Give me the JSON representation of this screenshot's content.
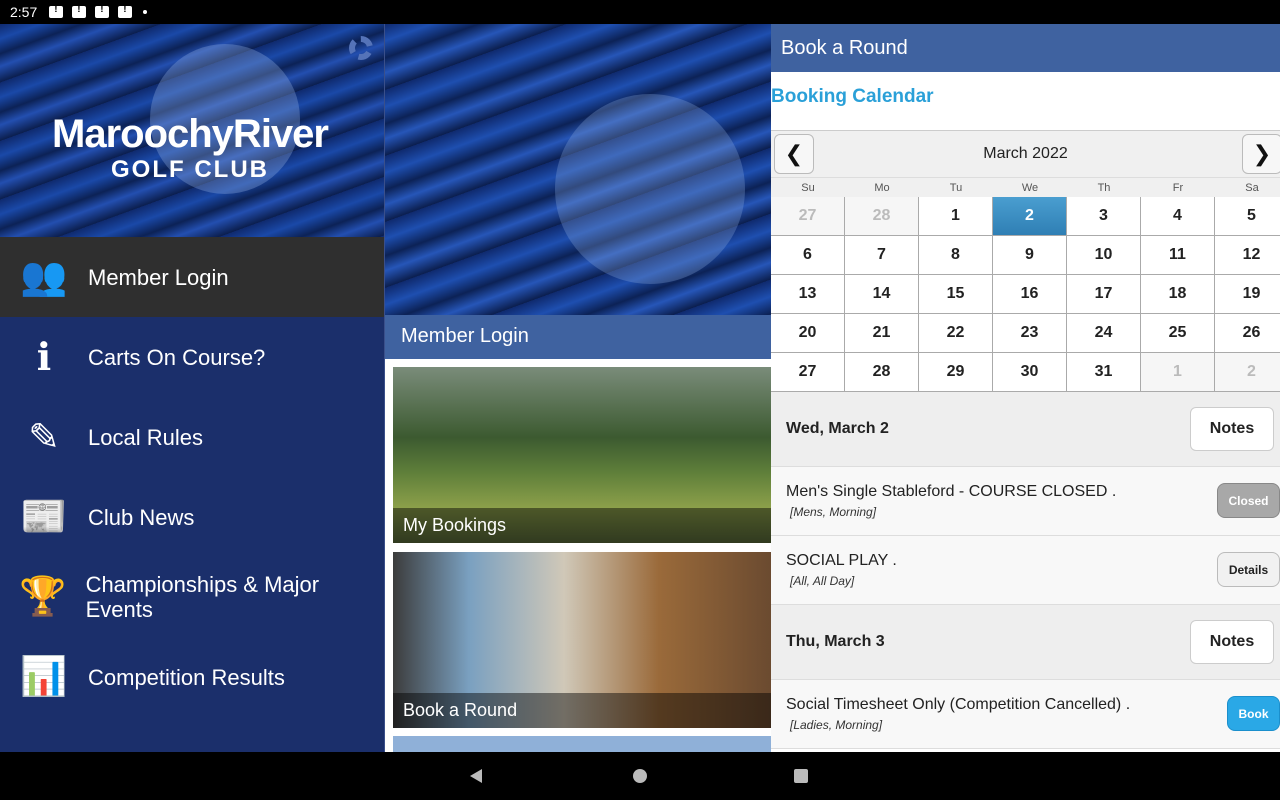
{
  "status_bar": {
    "time": "2:57"
  },
  "left_panel": {
    "logo": {
      "main": "MaroochyRiver",
      "sub": "GOLF CLUB"
    },
    "menu": [
      {
        "label": "Member Login",
        "icon": "members-icon",
        "active": true
      },
      {
        "label": "Carts On Course?",
        "icon": "info-icon",
        "active": false
      },
      {
        "label": "Local Rules",
        "icon": "edit-icon",
        "active": false
      },
      {
        "label": "Club News",
        "icon": "news-icon",
        "active": false
      },
      {
        "label": "Championships & Major Events",
        "icon": "trophy-icon",
        "active": false
      },
      {
        "label": "Competition Results",
        "icon": "bar-chart-icon",
        "active": false
      }
    ]
  },
  "middle_panel": {
    "header": "Member Login",
    "tiles": [
      {
        "label": "My Bookings"
      },
      {
        "label": "Book a Round"
      }
    ]
  },
  "right_panel": {
    "header": "Book a Round",
    "booking_calendar_label": "Booking Calendar",
    "calendar": {
      "month": "March 2022",
      "weekdays": [
        "Su",
        "Mo",
        "Tu",
        "We",
        "Th",
        "Fr",
        "Sa"
      ],
      "days": [
        {
          "d": "27",
          "m": true
        },
        {
          "d": "28",
          "m": true
        },
        {
          "d": "1"
        },
        {
          "d": "2",
          "s": true
        },
        {
          "d": "3"
        },
        {
          "d": "4"
        },
        {
          "d": "5"
        },
        {
          "d": "6"
        },
        {
          "d": "7"
        },
        {
          "d": "8"
        },
        {
          "d": "9"
        },
        {
          "d": "10"
        },
        {
          "d": "11"
        },
        {
          "d": "12"
        },
        {
          "d": "13"
        },
        {
          "d": "14"
        },
        {
          "d": "15"
        },
        {
          "d": "16"
        },
        {
          "d": "17"
        },
        {
          "d": "18"
        },
        {
          "d": "19"
        },
        {
          "d": "20"
        },
        {
          "d": "21"
        },
        {
          "d": "22"
        },
        {
          "d": "23"
        },
        {
          "d": "24"
        },
        {
          "d": "25"
        },
        {
          "d": "26"
        },
        {
          "d": "27"
        },
        {
          "d": "28"
        },
        {
          "d": "29"
        },
        {
          "d": "30"
        },
        {
          "d": "31"
        },
        {
          "d": "1",
          "m": true
        },
        {
          "d": "2",
          "m": true
        }
      ]
    },
    "schedule": [
      {
        "date": "Wed, March 2",
        "notes_label": "Notes",
        "events": [
          {
            "title": "Men's Single Stableford - COURSE CLOSED .",
            "sub": "[Mens, Morning]",
            "button": "Closed",
            "kind": "closed"
          },
          {
            "title": "SOCIAL PLAY .",
            "sub": "[All, All Day]",
            "button": "Details",
            "kind": "details"
          }
        ]
      },
      {
        "date": "Thu, March 3",
        "notes_label": "Notes",
        "events": [
          {
            "title": "Social Timesheet Only (Competition Cancelled) .",
            "sub": "[Ladies, Morning]",
            "button": "Book",
            "kind": "book"
          }
        ]
      }
    ]
  }
}
